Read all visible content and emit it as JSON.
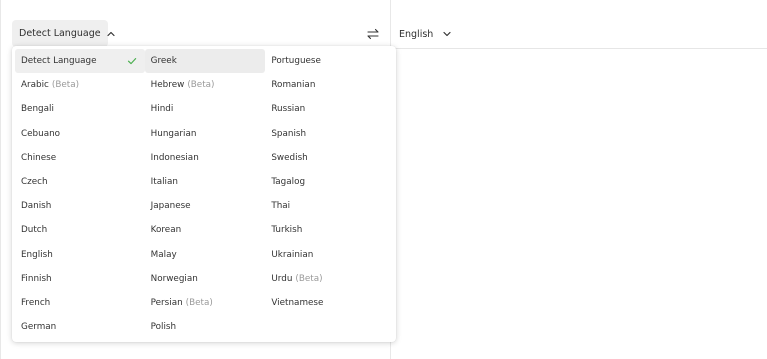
{
  "source_selector": {
    "label": "Detect Language"
  },
  "target_selector": {
    "label": "English"
  },
  "dropdown": {
    "columns": [
      [
        {
          "name": "Detect Language",
          "beta": "",
          "selected": true
        },
        {
          "name": "Arabic",
          "beta": "(Beta)"
        },
        {
          "name": "Bengali",
          "beta": ""
        },
        {
          "name": "Cebuano",
          "beta": ""
        },
        {
          "name": "Chinese",
          "beta": ""
        },
        {
          "name": "Czech",
          "beta": ""
        },
        {
          "name": "Danish",
          "beta": ""
        },
        {
          "name": "Dutch",
          "beta": ""
        },
        {
          "name": "English",
          "beta": ""
        },
        {
          "name": "Finnish",
          "beta": ""
        },
        {
          "name": "French",
          "beta": ""
        },
        {
          "name": "German",
          "beta": ""
        }
      ],
      [
        {
          "name": "Greek",
          "beta": "",
          "highlighted": true
        },
        {
          "name": "Hebrew",
          "beta": "(Beta)"
        },
        {
          "name": "Hindi",
          "beta": ""
        },
        {
          "name": "Hungarian",
          "beta": ""
        },
        {
          "name": "Indonesian",
          "beta": ""
        },
        {
          "name": "Italian",
          "beta": ""
        },
        {
          "name": "Japanese",
          "beta": ""
        },
        {
          "name": "Korean",
          "beta": ""
        },
        {
          "name": "Malay",
          "beta": ""
        },
        {
          "name": "Norwegian",
          "beta": ""
        },
        {
          "name": "Persian",
          "beta": "(Beta)"
        },
        {
          "name": "Polish",
          "beta": ""
        }
      ],
      [
        {
          "name": "Portuguese",
          "beta": ""
        },
        {
          "name": "Romanian",
          "beta": ""
        },
        {
          "name": "Russian",
          "beta": ""
        },
        {
          "name": "Spanish",
          "beta": ""
        },
        {
          "name": "Swedish",
          "beta": ""
        },
        {
          "name": "Tagalog",
          "beta": ""
        },
        {
          "name": "Thai",
          "beta": ""
        },
        {
          "name": "Turkish",
          "beta": ""
        },
        {
          "name": "Ukrainian",
          "beta": ""
        },
        {
          "name": "Urdu",
          "beta": "(Beta)"
        },
        {
          "name": "Vietnamese",
          "beta": ""
        }
      ]
    ]
  },
  "icons": {
    "source_chevron": "chevron-up-icon",
    "target_chevron": "chevron-down-icon",
    "swap": "swap-arrows-icon",
    "selected_check": "check-icon"
  },
  "colors": {
    "selected_bg": "#efefef",
    "check": "#4caf50",
    "beta_text": "#9a9a9a"
  }
}
